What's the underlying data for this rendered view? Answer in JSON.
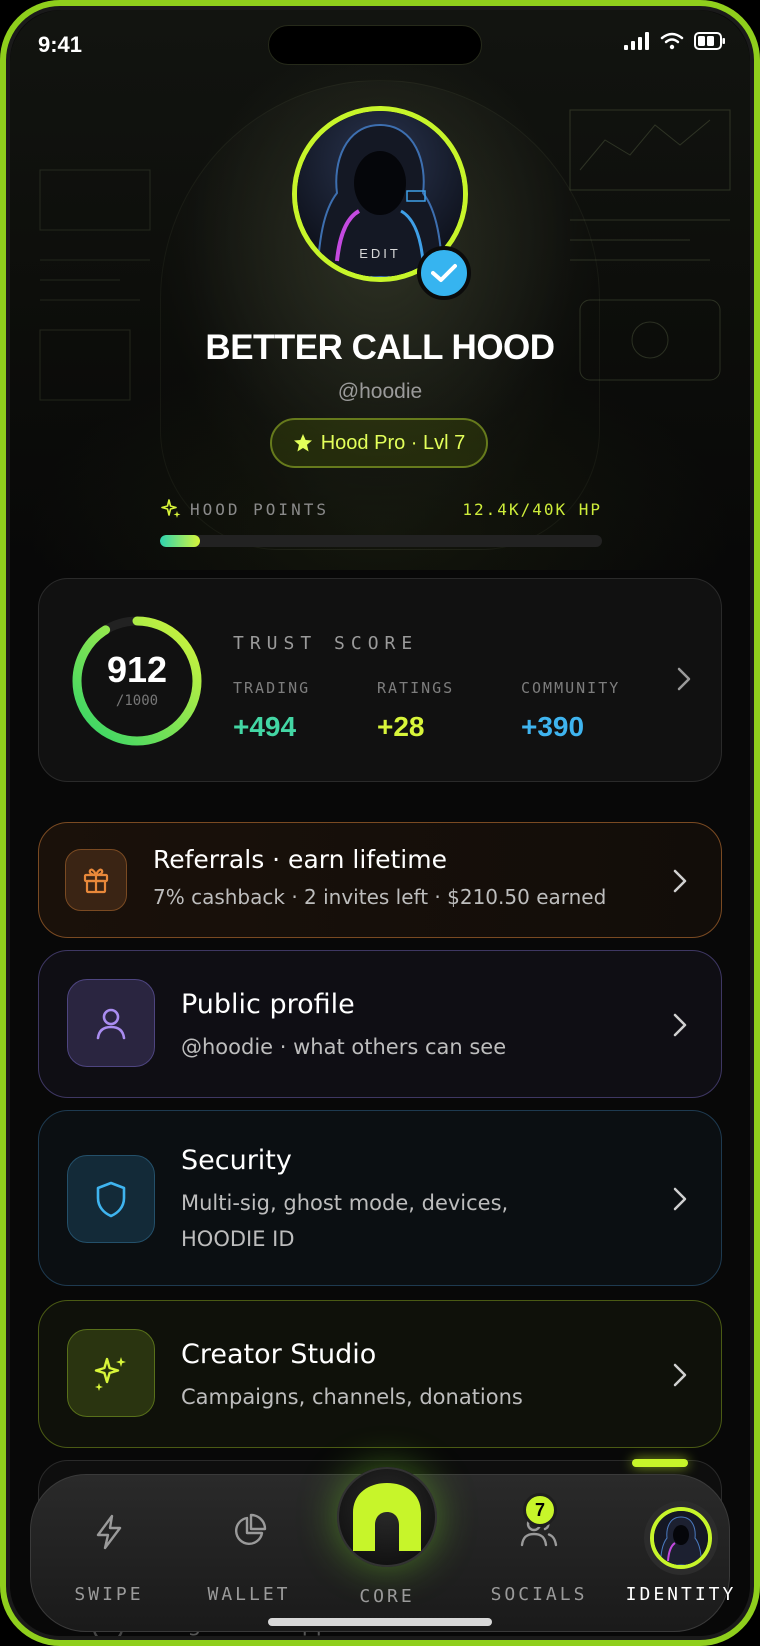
{
  "status_bar": {
    "time": "9:41"
  },
  "profile": {
    "edit_label": "EDIT",
    "name": "BETTER CALL HOOD",
    "handle": "@hoodie",
    "tier": "Hood Pro · Lvl 7",
    "points_label": "HOOD POINTS",
    "points_value": "12.4K/40K HP",
    "points_progress": 0.09
  },
  "trust": {
    "title": "TRUST SCORE",
    "score": "912",
    "max": "/1000",
    "score_fraction": 0.912,
    "stats": [
      {
        "label": "TRADING",
        "value": "+494",
        "color": "#43d6a4"
      },
      {
        "label": "RATINGS",
        "value": "+28",
        "color": "#d8f53a"
      },
      {
        "label": "COMMUNITY",
        "value": "+390",
        "color": "#3fb4ef"
      }
    ]
  },
  "rows": [
    {
      "title": "Referrals · earn lifetime",
      "sub": "7% cashback · 2 invites left · $210.50 earned",
      "icon": "gift-icon",
      "accent": "#e8883a"
    },
    {
      "title": "Public profile",
      "sub": "@hoodie · what others can see",
      "icon": "user-icon",
      "accent": "#9a80e8"
    },
    {
      "title": "Security",
      "sub": "Multi-sig, ghost mode, devices,",
      "sub2": "HOODIE ID",
      "icon": "shield-icon",
      "accent": "#3fb4ef"
    },
    {
      "title": "Creator Studio",
      "sub": "Campaigns, channels, donations",
      "icon": "sparkle-icon",
      "accent": "#d8f53a"
    }
  ],
  "hidden_row": {
    "label": "Legal and support"
  },
  "tabs": [
    {
      "label": "SWIPE",
      "icon": "bolt-icon"
    },
    {
      "label": "WALLET",
      "icon": "pie-chart-icon"
    },
    {
      "label": "CORE",
      "icon": "hood-logo-icon"
    },
    {
      "label": "SOCIALS",
      "icon": "users-icon",
      "badge": "7"
    },
    {
      "label": "IDENTITY",
      "icon": "avatar-icon",
      "active": true
    }
  ],
  "colors": {
    "accent": "#c7f52a",
    "background": "#080808"
  }
}
